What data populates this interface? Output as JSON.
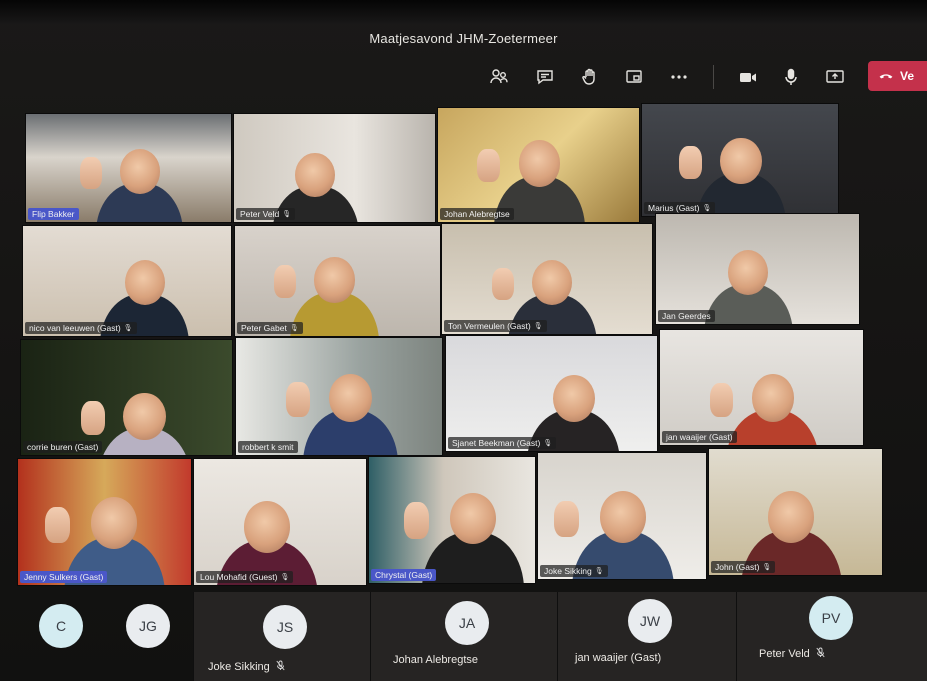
{
  "meeting": {
    "title": "Maatjesavond JHM-Zoetermeer"
  },
  "toolbar": {
    "buttons": [
      {
        "icon": "participants-icon"
      },
      {
        "icon": "chat-icon"
      },
      {
        "icon": "raise-hand-icon"
      },
      {
        "icon": "breakout-rooms-icon"
      },
      {
        "icon": "more-options-icon"
      },
      {
        "icon": "camera-icon"
      },
      {
        "icon": "microphone-icon"
      },
      {
        "icon": "share-screen-icon"
      }
    ],
    "leave_label": "Ve",
    "leave_color": "#c4314b"
  },
  "participants": [
    {
      "name": "Flip Bakker",
      "muted": false,
      "highlight": true
    },
    {
      "name": "Peter Veld",
      "muted": true,
      "highlight": false
    },
    {
      "name": "Johan Alebregtse",
      "muted": false,
      "highlight": false
    },
    {
      "name": "Marius (Gast)",
      "muted": true,
      "highlight": false
    },
    {
      "name": "nico van leeuwen (Gast)",
      "muted": true,
      "highlight": false
    },
    {
      "name": "Peter Gabet",
      "muted": true,
      "highlight": false
    },
    {
      "name": "Ton Vermeulen (Gast)",
      "muted": true,
      "highlight": false
    },
    {
      "name": "Jan Geerdes",
      "muted": false,
      "highlight": false
    },
    {
      "name": "corrie buren (Gast)",
      "muted": false,
      "highlight": false
    },
    {
      "name": "robbert k smit",
      "muted": false,
      "highlight": false
    },
    {
      "name": "Sjanet Beekman (Gast)",
      "muted": true,
      "highlight": false
    },
    {
      "name": "jan waaijer (Gast)",
      "muted": false,
      "highlight": false
    },
    {
      "name": "Jenny Sulkers (Gast)",
      "muted": false,
      "highlight": true
    },
    {
      "name": "Lou Mohafid (Guest)",
      "muted": true,
      "highlight": false
    },
    {
      "name": "Chrystal (Gast)",
      "muted": false,
      "highlight": true
    },
    {
      "name": "Joke Sikking",
      "muted": true,
      "highlight": false
    },
    {
      "name": "John (Gast)",
      "muted": true,
      "highlight": false
    }
  ],
  "bottom_participants": [
    {
      "initials": "C",
      "name": ""
    },
    {
      "initials": "JG",
      "name": ""
    },
    {
      "initials": "JS",
      "name": "Joke Sikking"
    },
    {
      "initials": "JA",
      "name": "Johan Alebregtse"
    },
    {
      "initials": "JW",
      "name": "jan waaijer (Gast)"
    },
    {
      "initials": "PV",
      "name": "Peter Veld"
    }
  ]
}
